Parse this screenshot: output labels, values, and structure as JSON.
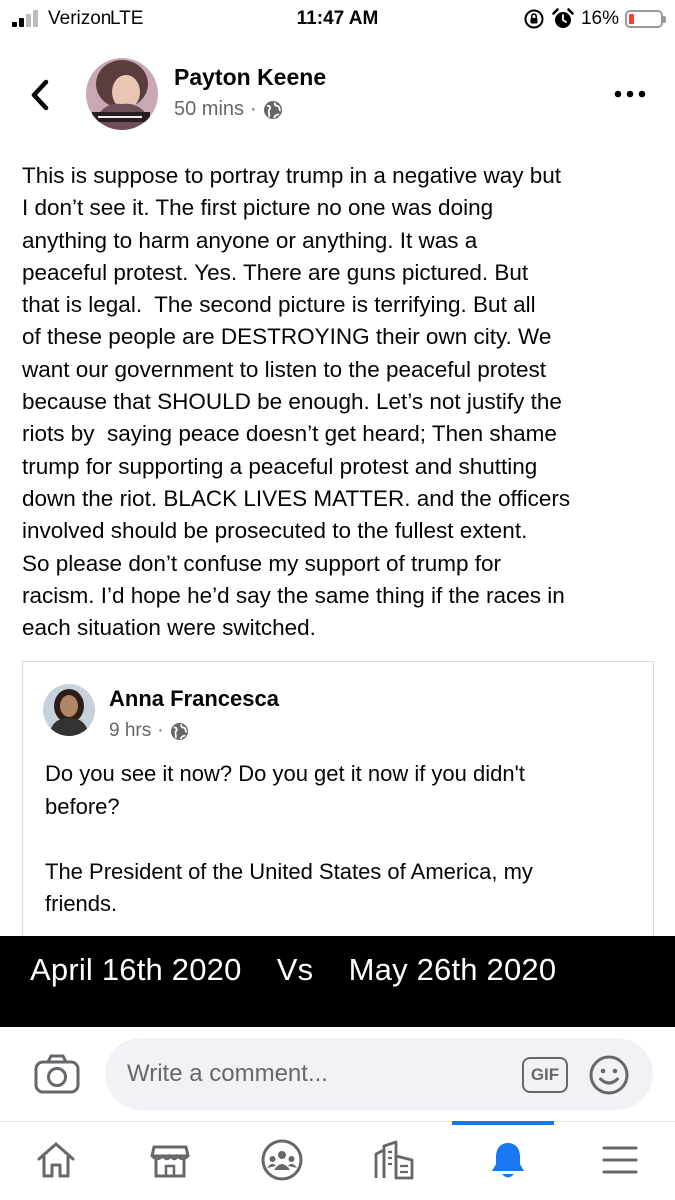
{
  "status_bar": {
    "carrier": "Verizon",
    "network": "LTE",
    "time": "11:47 AM",
    "battery_percent": "16%",
    "battery_level": 0.16,
    "icons": [
      "signal-icon",
      "rotation-lock-icon",
      "alarm-icon",
      "battery-icon"
    ]
  },
  "post": {
    "author": "Payton Keene",
    "time_ago": "50 mins",
    "separator": "·",
    "audience_icon": "globe-icon",
    "text": "This is suppose to portray trump in a negative way but\nI don’t see it. The first picture no one was doing\nanything to harm anyone or anything. It was a\npeaceful protest. Yes. There are guns pictured. But\nthat is legal.  The second picture is terrifying. But all\nof these people are DESTROYING their own city. We\nwant our government to listen to the peaceful protest\nbecause that SHOULD be enough. Let’s not justify the\nriots by  saying peace doesn’t get heard; Then shame\ntrump for supporting a peaceful protest and shutting\ndown the riot. BLACK LIVES MATTER. and the officers\ninvolved should be prosecuted to the fullest extent.\nSo please don’t confuse my support of trump for\nracism. I’d hope he’d say the same thing if the races in\neach situation were switched."
  },
  "shared_post": {
    "author": "Anna Francesca",
    "time_ago": "9 hrs",
    "separator": "·",
    "text": "Do you see it now? Do you get it now if you didn't\nbefore?\n\nThe President of the United States of America, my\nfriends.",
    "image_caption": "April 16th 2020    Vs    May 26th 2020"
  },
  "comment_bar": {
    "placeholder": "Write a comment...",
    "gif_label": "GIF"
  },
  "tab_bar": {
    "tabs": [
      {
        "name": "home",
        "icon": "home-icon"
      },
      {
        "name": "marketplace",
        "icon": "marketplace-icon"
      },
      {
        "name": "groups",
        "icon": "groups-icon"
      },
      {
        "name": "news",
        "icon": "news-icon"
      },
      {
        "name": "notifications",
        "icon": "bell-icon",
        "active": true
      },
      {
        "name": "menu",
        "icon": "menu-icon"
      }
    ]
  },
  "colors": {
    "accent": "#1877f2",
    "secondary_text": "#65676b",
    "battery_low": "#ff3b30",
    "banner_bg": "#000000"
  }
}
